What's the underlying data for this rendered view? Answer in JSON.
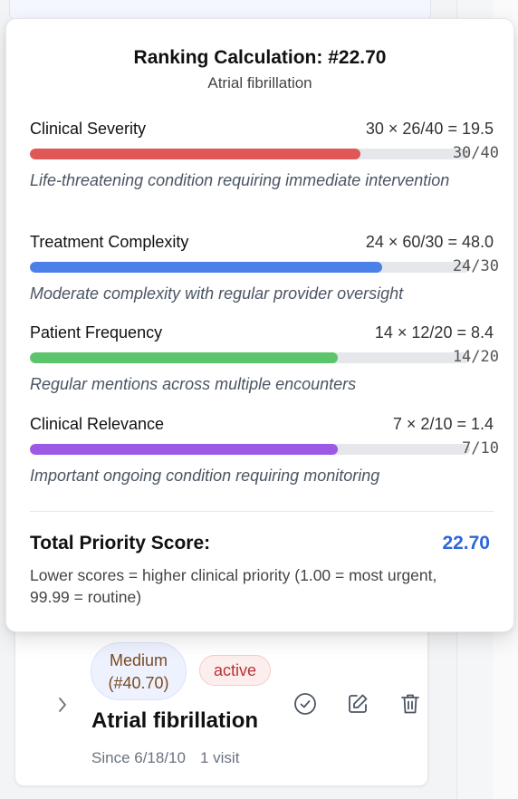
{
  "popover": {
    "title": "Ranking Calculation: #22.70",
    "subtitle": "Atrial fibrillation",
    "metrics": [
      {
        "name": "Clinical Severity",
        "formula": "30 × 26/40 = 19.5",
        "score": "30/40",
        "fraction": 0.75,
        "color": "#e05757",
        "description": "Life-threatening condition requiring immediate intervention"
      },
      {
        "name": "Treatment Complexity",
        "formula": "24 × 60/30 = 48.0",
        "score": "24/30",
        "fraction": 0.8,
        "color": "#4a80e8",
        "description": "Moderate complexity with regular provider oversight"
      },
      {
        "name": "Patient Frequency",
        "formula": "14 × 12/20 = 8.4",
        "score": "14/20",
        "fraction": 0.7,
        "color": "#5cc46a",
        "description": "Regular mentions across multiple encounters"
      },
      {
        "name": "Clinical Relevance",
        "formula": "7 × 2/10 = 1.4",
        "score": "7/10",
        "fraction": 0.7,
        "color": "#9b59e6",
        "description": "Important ongoing condition requiring monitoring"
      }
    ],
    "total_label": "Total Priority Score:",
    "total_value": "22.70",
    "note": "Lower scores = higher clinical priority (1.00 = most urgent, 99.99 = routine)"
  },
  "card": {
    "priority_line1": "Medium",
    "priority_line2": "(#40.70)",
    "status": "active",
    "title": "Atrial fibrillation",
    "since": "Since 6/18/10",
    "visits": "1 visit"
  },
  "icons": {
    "expand": "chevron-right-icon",
    "resolve": "check-circle-icon",
    "edit": "edit-icon",
    "delete": "trash-icon"
  }
}
